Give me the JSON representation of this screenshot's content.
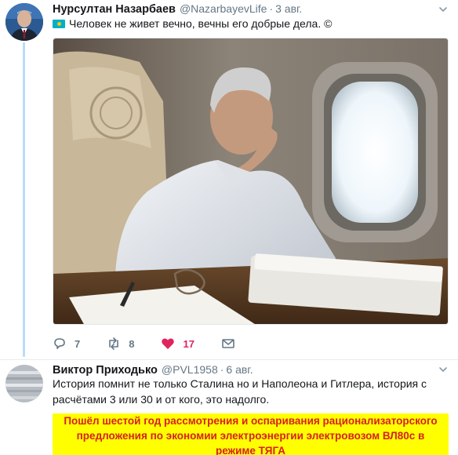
{
  "tweets": [
    {
      "author_name": "Нурсултан Назарбаев",
      "author_handle": "@NazarbayevLife",
      "separator": "·",
      "time": "3 авг.",
      "text": "Человек не живет вечно, вечны его добрые дела. ©",
      "actions": [
        {
          "icon": "reply-icon",
          "count": "7"
        },
        {
          "icon": "retweet-icon",
          "count": "8"
        },
        {
          "icon": "heart-icon",
          "count": "17",
          "color": "#e0245e"
        },
        {
          "icon": "direct-message-icon",
          "count": ""
        }
      ]
    },
    {
      "author_name": "Виктор Приходько",
      "author_handle": "@PVL1958",
      "separator": "·",
      "time": "6 авг.",
      "text": "История помнит не только Сталина но и Наполеона и Гитлера, история с расчётами 3 или 30 и от кого, это надолго.",
      "promo_text": "Пошёл шестой год рассмотрения и оспаривания рационализаторского предложения по экономии электроэнергии электровозом ВЛ80с в режиме ТЯГА",
      "promo_bg": "#ffff00",
      "promo_color": "#d61f1f"
    }
  ],
  "colors": {
    "thread_line": "#b9dcf7",
    "secondary_text": "#657786",
    "like_active": "#e0245e"
  }
}
